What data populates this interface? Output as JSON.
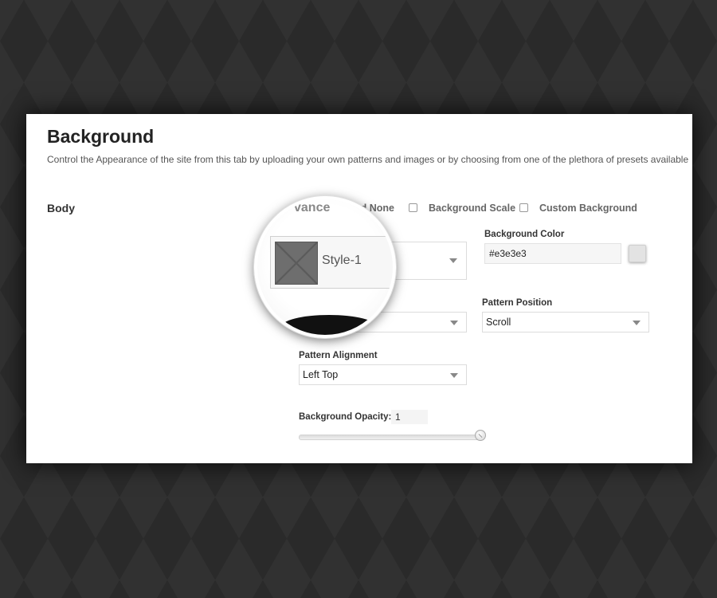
{
  "header": {
    "title": "Background",
    "description": "Control the Appearance of the site from this tab by uploading your own patterns and images or by choosing from one of the plethora of presets available"
  },
  "body_section": {
    "label": "Body",
    "options": {
      "bg_none_label": "nd None",
      "bg_scale_label": "Background Scale",
      "custom_bg_label": "Custom Background"
    }
  },
  "magnifier": {
    "partial_label": "vance",
    "pattern_value": "Style-1"
  },
  "background_color": {
    "label": "Background Color",
    "value": "#e3e3e3",
    "swatch": "#e3e3e3"
  },
  "pattern_position": {
    "label": "Pattern Position",
    "value": "Scroll"
  },
  "pattern_alignment": {
    "label": "Pattern Alignment",
    "value": "Left Top"
  },
  "background_opacity": {
    "label": "Background Opacity:",
    "value": "1",
    "slider_level": 1
  }
}
